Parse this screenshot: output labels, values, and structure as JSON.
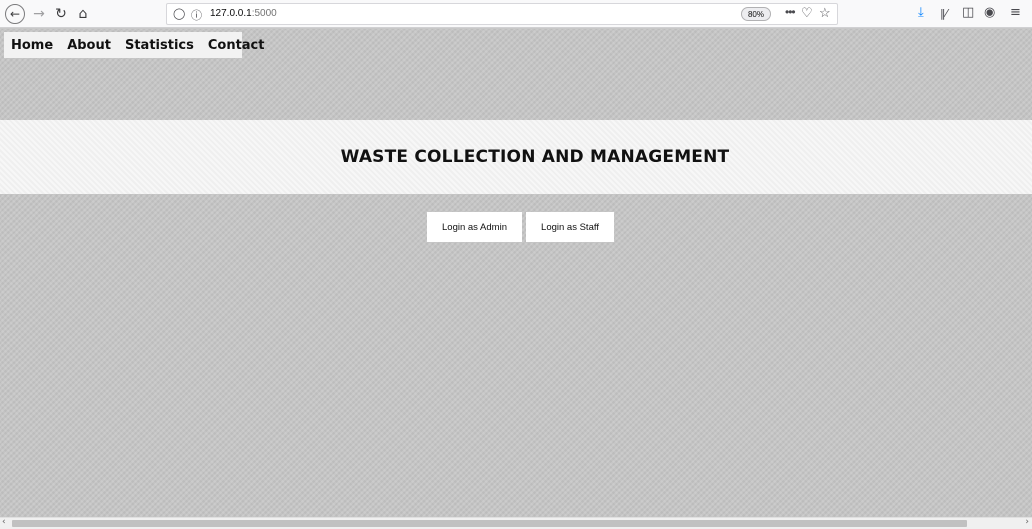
{
  "browser": {
    "url_host": "127.0.0.1",
    "url_port": ":5000",
    "zoom": "80%",
    "icons": {
      "back": "back-arrow-icon",
      "forward": "forward-arrow-icon",
      "reload": "reload-icon",
      "home": "home-icon",
      "shield": "tracking-shield-icon",
      "info": "site-info-icon",
      "more": "page-actions-icon",
      "pocket": "pocket-icon",
      "bookmark": "bookmark-star-icon",
      "download": "download-icon",
      "library": "library-icon",
      "sidebar": "sidebar-icon",
      "account": "account-icon",
      "menu": "hamburger-menu-icon"
    }
  },
  "nav": {
    "items": [
      {
        "label": "Home"
      },
      {
        "label": "About"
      },
      {
        "label": "Statistics"
      },
      {
        "label": "Contact"
      }
    ]
  },
  "banner": {
    "title": "WASTE COLLECTION AND MANAGEMENT"
  },
  "actions": {
    "admin_label": "Login as Admin",
    "staff_label": "Login as Staff"
  },
  "colors": {
    "page_background": "#c6c6c6",
    "banner_background": "#efefef",
    "navbar_background": "#f2f2f2",
    "button_background": "#ffffff",
    "download_accent": "#0a84ff"
  }
}
